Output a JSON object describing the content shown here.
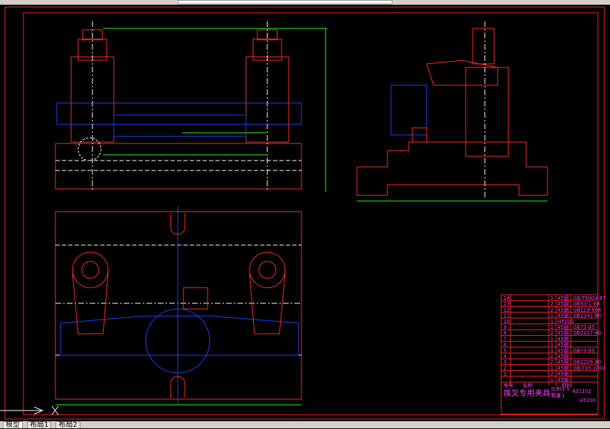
{
  "app": {
    "view": "CAD drawing canvas"
  },
  "tabs": [
    {
      "label": "模型",
      "active": true
    },
    {
      "label": "布局1"
    },
    {
      "label": "布局2"
    }
  ],
  "title_block": {
    "title": "拨叉专用夹具",
    "drawing_no": "831102",
    "scale_label": "比例",
    "scale": "1:1",
    "qty_label": "数量",
    "qty": "1",
    "material": "HT200",
    "rows": [
      {
        "no": "14",
        "qty": "1",
        "mat": "45钢",
        "std": "GB/T6004-87"
      },
      {
        "no": "13",
        "qty": "2",
        "mat": "45钢",
        "std": "GB93-1-88"
      },
      {
        "no": "12",
        "qty": "2",
        "mat": "45钢",
        "std": "GB119-86A"
      },
      {
        "no": "11",
        "qty": "1",
        "mat": "45钢",
        "std": "GB2341-80"
      },
      {
        "no": "10",
        "qty": "1",
        "mat": "HT200",
        "std": ""
      },
      {
        "no": "9",
        "qty": "1",
        "mat": "45钢",
        "std": "GB73-85"
      },
      {
        "no": "8",
        "qty": "2",
        "mat": "45钢",
        "std": "GB2207-80"
      },
      {
        "no": "7",
        "qty": "1",
        "mat": "45钢",
        "std": ""
      },
      {
        "no": "6",
        "qty": "1",
        "mat": "45钢",
        "std": ""
      },
      {
        "no": "5",
        "qty": "1",
        "mat": "45钢",
        "std": "GB73-85"
      },
      {
        "no": "4",
        "qty": "2",
        "mat": "45钢",
        "std": ""
      },
      {
        "no": "3",
        "qty": "2",
        "mat": "45钢",
        "std": "GB2208-80"
      },
      {
        "no": "2",
        "qty": "1",
        "mat": "45钢",
        "std": "GB/T95-2002"
      },
      {
        "no": "1",
        "qty": "2",
        "mat": "45钢",
        "std": ""
      },
      {
        "no": "",
        "qty": "1",
        "mat": "45钢",
        "std": ""
      }
    ],
    "header": {
      "no": "序号",
      "name": "名称",
      "mat": "材料"
    }
  },
  "colors": {
    "frame": "#ff2020",
    "part": "#ff2a2a",
    "hidden": "#2040ff",
    "dim": "#20ff20",
    "text": "#ff3cff",
    "center": "#ffffff"
  }
}
